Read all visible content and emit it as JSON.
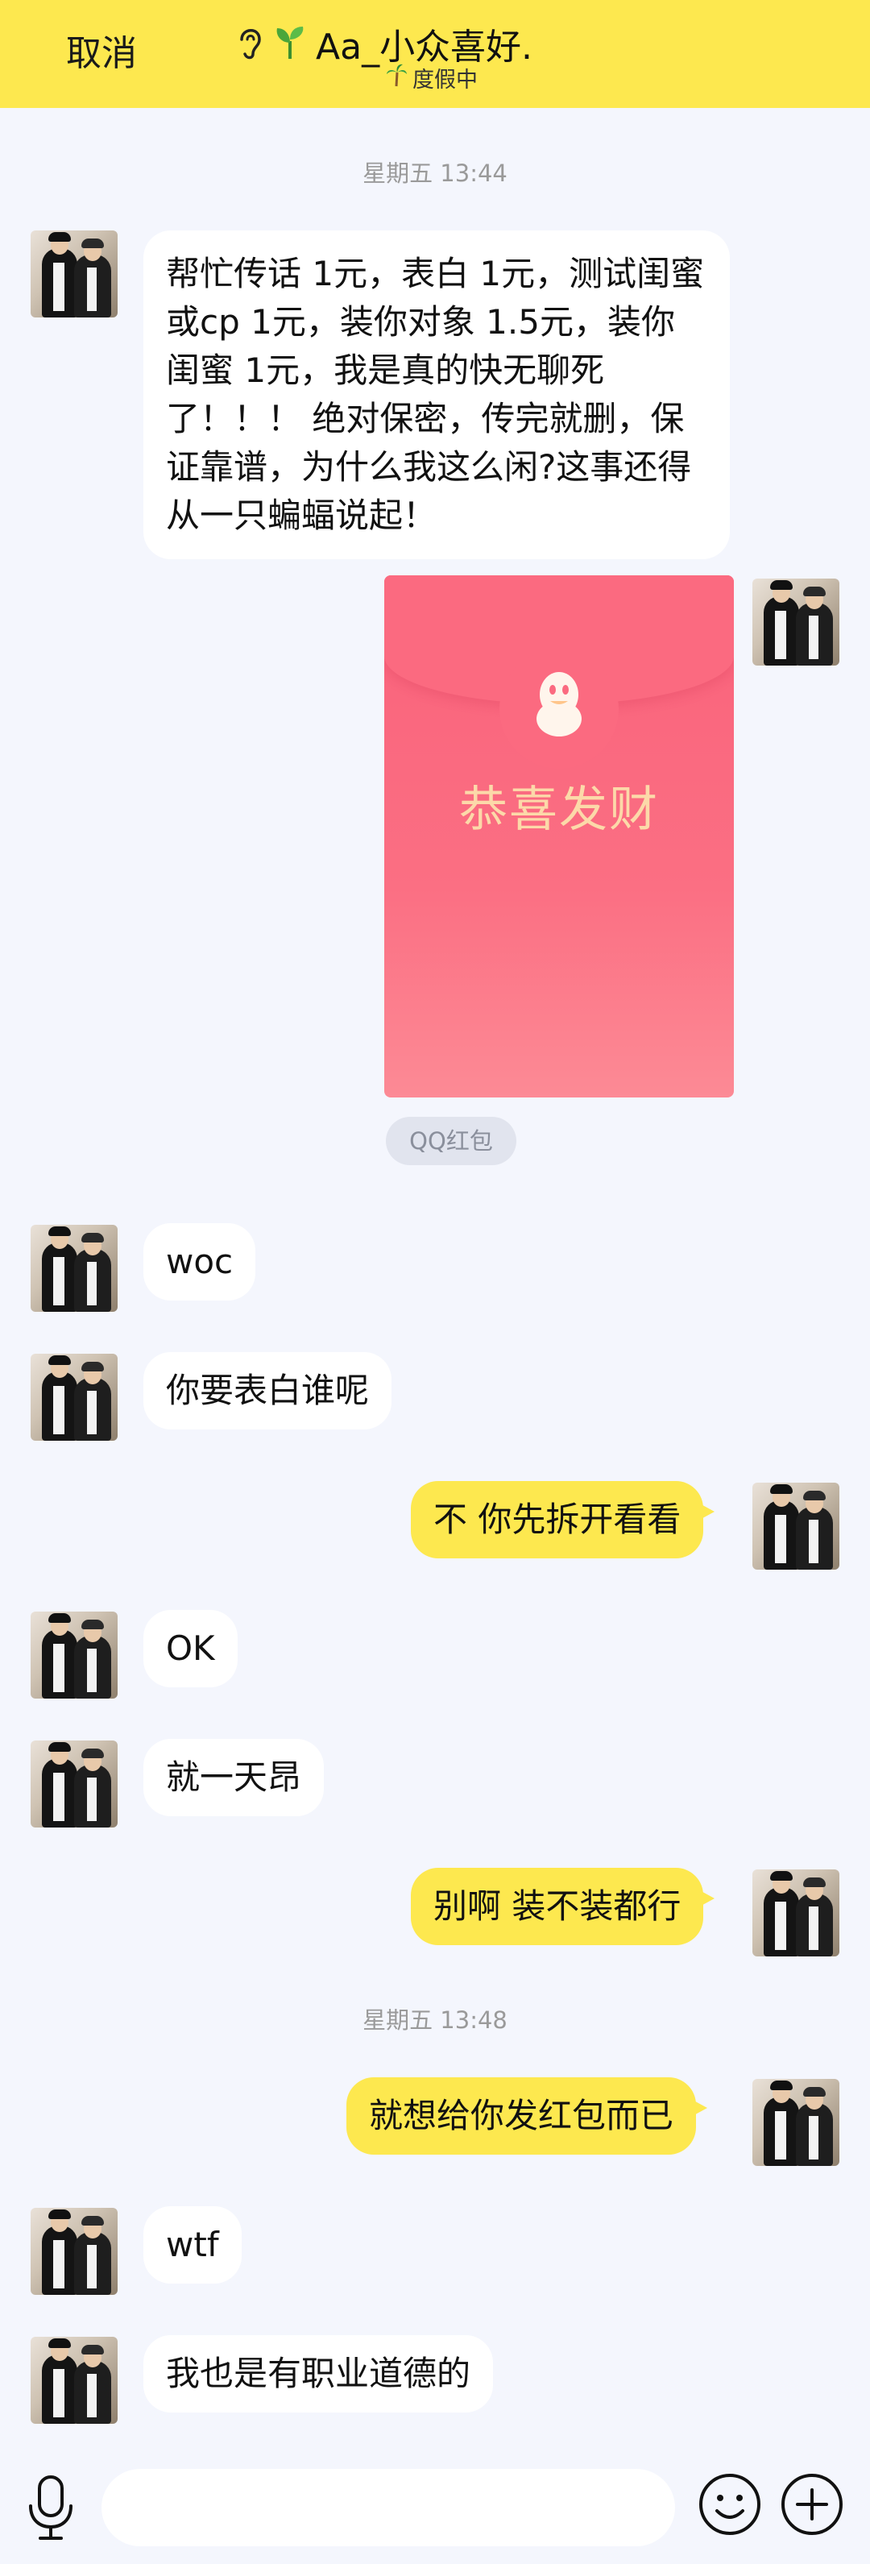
{
  "header": {
    "cancel_label": "取消",
    "contact_name": "Aa_小众喜好.",
    "status_text": "度假中",
    "accent_color": "#fde84f"
  },
  "timestamps": {
    "t1": "星期五 13:44",
    "t2": "星期五 13:48"
  },
  "messages": {
    "m1": "帮忙传话 1元，表白 1元，测试闺蜜或cp 1元，装你对象 1.5元，装你闺蜜 1元，我是真的快无聊死了！！！ 绝对保密，传完就删，保证靠谱，为什么我这么闲?这事还得从一只蝙蝠说起！",
    "m3": "woc",
    "m4": "你要表白谁呢",
    "m5": "不 你先拆开看看",
    "m6": "OK",
    "m7": "就一天昂",
    "m8": "别啊 装不装都行",
    "m9": "就想给你发红包而已",
    "m10": "wtf",
    "m11": "我也是有职业道德的"
  },
  "red_packet": {
    "greeting": "恭喜发财",
    "tag": "QQ红包",
    "color": "#f9627b"
  },
  "icons": {
    "header": [
      "ear-icon",
      "sprout-icon",
      "palm-tree-icon"
    ],
    "input_bar": [
      "microphone-icon",
      "emoji-icon",
      "plus-icon"
    ]
  }
}
